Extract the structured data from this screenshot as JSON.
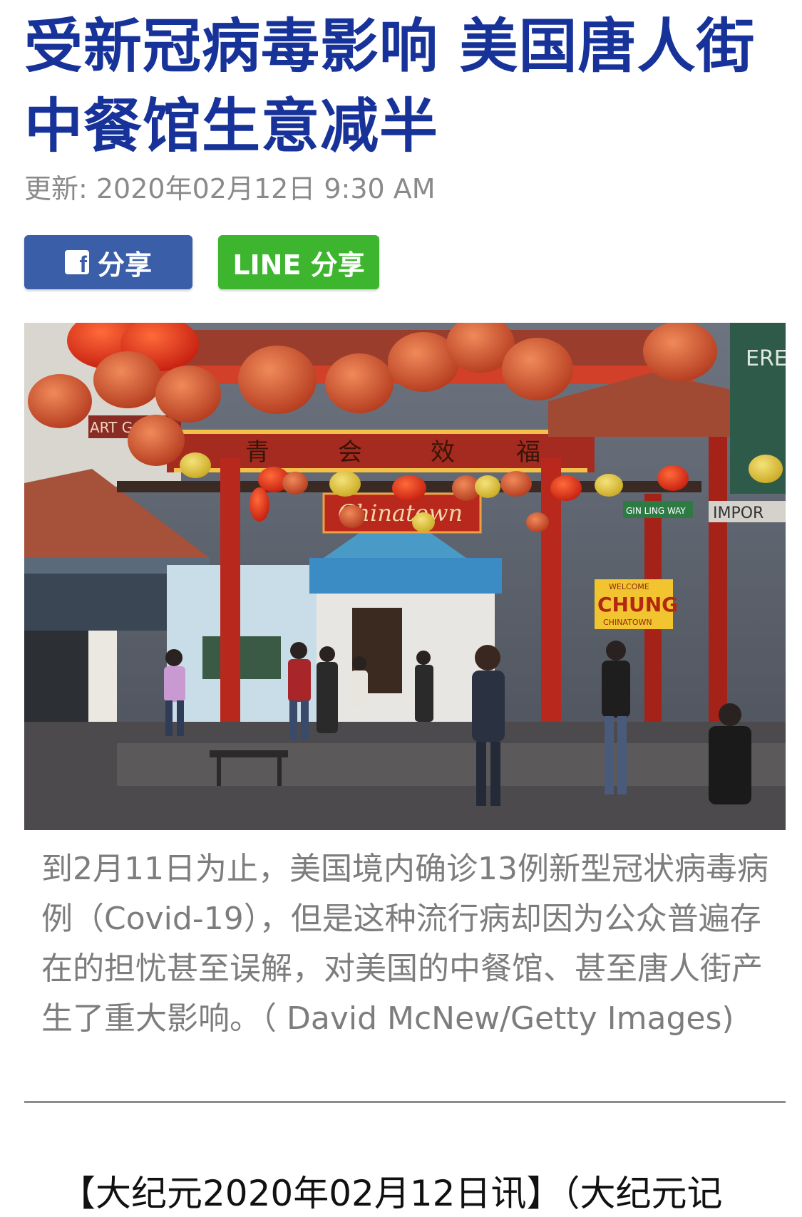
{
  "article": {
    "title": "受新冠病毒影响 美国唐人街中餐馆生意减半",
    "updated": "更新: 2020年02月12日 9:30 AM"
  },
  "share": {
    "facebook_label": "分享",
    "facebook_icon": "f",
    "line_label": "LINE 分享"
  },
  "photo": {
    "sign_text": "Chinatown",
    "shop_sign": "ART GOODS",
    "banner_text": "CHUNG",
    "banner_small": "WELCOME",
    "banner_sub": "CHINATOWN",
    "gate_chars": [
      "青",
      "会",
      "效",
      "福"
    ],
    "street_sign": "GIN LING WAY",
    "right_sign": "IMPOR",
    "side_letters": "ERE"
  },
  "caption": {
    "text": "到2月11日为止，美国境内确诊13例新型冠状病毒病例（Covid-19），但是这种流行病却因为公众普遍存在的担忧甚至误解，对美国的中餐馆、甚至唐人街产生了重大影响。（ David McNew/Getty Images)"
  },
  "body": {
    "lead": "【大纪元2020年02月12日讯】（大纪元记"
  },
  "colors": {
    "headline": "#17339a",
    "facebook": "#3b5ea8",
    "line": "#3eb52f"
  }
}
